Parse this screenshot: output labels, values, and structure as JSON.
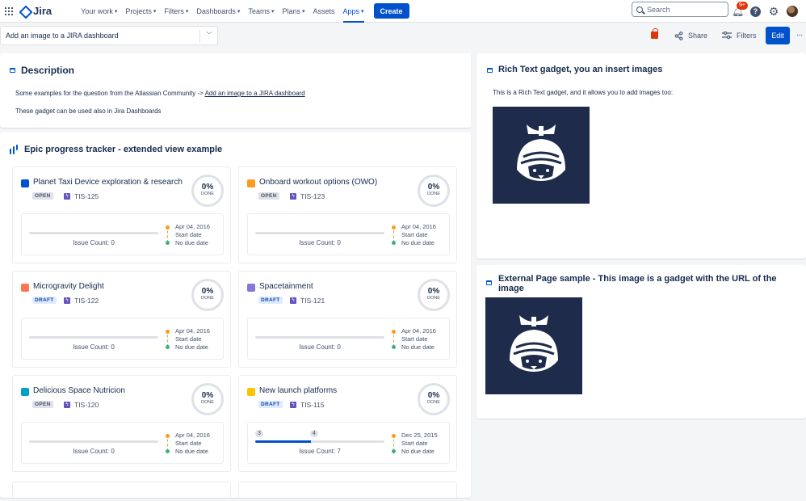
{
  "nav": {
    "logo": "Jira",
    "items": [
      "Your work",
      "Projects",
      "Filters",
      "Dashboards",
      "Teams",
      "Plans",
      "Assets",
      "Apps"
    ],
    "create": "Create",
    "search_placeholder": "Search",
    "notifications": "9+",
    "icons": [
      "apps-grid-icon",
      "jira-logo-icon",
      "search-icon",
      "bell-icon",
      "help-icon",
      "gear-icon",
      "avatar"
    ]
  },
  "toolbar": {
    "dashboard_name": "Add an image to a JIRA dashboard",
    "share": "Share",
    "filters": "Filters",
    "edit": "Edit",
    "more": "···"
  },
  "description": {
    "title": "Description",
    "line1_prefix": "Some examples for the question from the Atlassian Community -> ",
    "line1_link": "Add an image to a JIRA dashboard",
    "line2": "These gadget can be used also in Jira Dashboards"
  },
  "epic_gadget": {
    "title": "Epic progress tracker - extended view example",
    "cards": [
      {
        "name": "Planet Taxi Device exploration & research",
        "color": "#0052cc",
        "status": "OPEN",
        "ticket": "TIS-125",
        "percent": "0%",
        "done": "DONE",
        "progress": 0,
        "count": "Issue Count: 0",
        "date": "Apr 04, 2016",
        "start": "Start date",
        "due": "No due date"
      },
      {
        "name": "Onboard workout options (OWO)",
        "color": "#ff991f",
        "status": "OPEN",
        "ticket": "TIS-123",
        "percent": "0%",
        "done": "DONE",
        "progress": 0,
        "count": "Issue Count: 0",
        "date": "Apr 04, 2016",
        "start": "Start date",
        "due": "No due date"
      },
      {
        "name": "Microgravity Delight",
        "color": "#ff7452",
        "status": "DRAFT",
        "ticket": "TIS-122",
        "percent": "0%",
        "done": "DONE",
        "progress": 0,
        "count": "Issue Count: 0",
        "date": "Apr 04, 2016",
        "start": "Start date",
        "due": "No due date"
      },
      {
        "name": "Spacetainment",
        "color": "#8777d9",
        "status": "DRAFT",
        "ticket": "TIS-121",
        "percent": "0%",
        "done": "DONE",
        "progress": 0,
        "count": "Issue Count: 0",
        "date": "Apr 04, 2016",
        "start": "Start date",
        "due": "No due date"
      },
      {
        "name": "Delicious Space Nutricion",
        "color": "#00a3bf",
        "status": "OPEN",
        "ticket": "TIS-120",
        "percent": "0%",
        "done": "DONE",
        "progress": 0,
        "count": "Issue Count: 0",
        "date": "Apr 04, 2016",
        "start": "Start date",
        "due": "No due date"
      },
      {
        "name": "New launch platforms",
        "color": "#ffc400",
        "status": "DRAFT",
        "ticket": "TIS-115",
        "percent": "0%",
        "done": "DONE",
        "progress": 0.43,
        "segments": [
          "3",
          "4"
        ],
        "count": "Issue Count: 7",
        "date": "Dec 25, 2015",
        "start": "Start date",
        "due": "No due date"
      }
    ]
  },
  "rich_text": {
    "title": "Rich Text gadget, you an insert images",
    "text": "This is a Rich Text gadget, and it allows you to add images too:"
  },
  "external": {
    "title": "External Page sample - This image is a gadget with the URL of the image"
  },
  "colors": {
    "brand": "#0052cc",
    "image_bg": "#1e2b4b"
  }
}
